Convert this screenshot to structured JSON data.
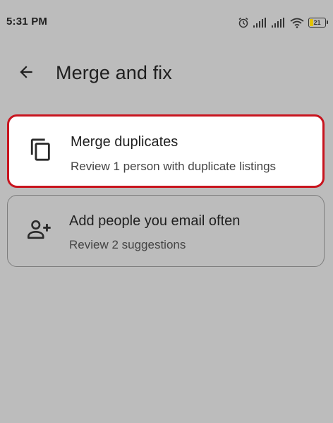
{
  "status_bar": {
    "time": "5:31 PM",
    "battery_level": "21",
    "battery_fraction": 0.21,
    "icons": [
      "alarm-icon",
      "signal-icon",
      "signal-icon",
      "wifi-icon",
      "battery-icon"
    ]
  },
  "app_bar": {
    "title": "Merge and fix",
    "back_icon": "arrow-back-icon"
  },
  "cards": [
    {
      "title": "Merge duplicates",
      "subtitle": "Review 1 person with duplicate listings",
      "icon": "copy-icon"
    },
    {
      "title": "Add people you email often",
      "subtitle": "Review 2 suggestions",
      "icon": "person-add-icon"
    }
  ],
  "colors": {
    "background": "#bcbcbc",
    "highlight_border": "#c8141e",
    "card_background": "#ffffff",
    "card_outline": "#7e7e7e"
  }
}
